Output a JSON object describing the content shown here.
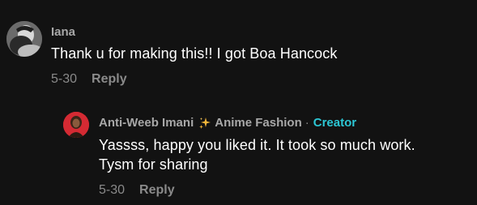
{
  "comments": [
    {
      "username": "Iana",
      "text": "Thank u for making this!! I got Boa Hancock",
      "date": "5-30",
      "reply_label": "Reply"
    }
  ],
  "reply": {
    "username": "Anti-Weeb Imani",
    "sparkle_icon": "sparkles-icon",
    "username_suffix": "Anime Fashion",
    "separator": "·",
    "badge": "Creator",
    "text_line1": "Yassss, happy you liked it. It took so much work.",
    "text_line2": "Tysm for sharing",
    "date": "5-30",
    "reply_label": "Reply"
  },
  "colors": {
    "background": "#121212",
    "username": "#a8a8a8",
    "body_text": "#ffffff",
    "meta_text": "#8a8a8a",
    "creator_badge": "#2cc6d4",
    "reply_avatar_bg": "#d42a33"
  }
}
